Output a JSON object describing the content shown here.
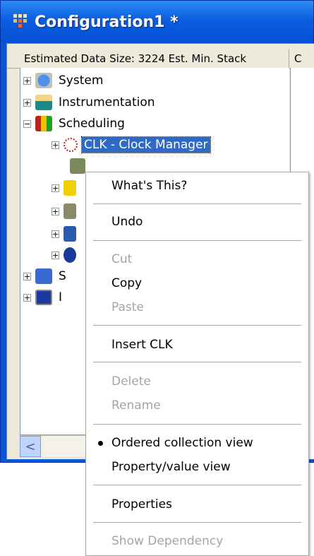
{
  "window": {
    "title": "Configuration1 *",
    "accent_color": "#0a57d6"
  },
  "header": {
    "column_1": "Estimated Data Size: 3224   Est. Min. Stack",
    "column_2": "C"
  },
  "tree": {
    "items": [
      {
        "label": "System",
        "expander": "+",
        "icon": "system-globe-icon"
      },
      {
        "label": "Instrumentation",
        "expander": "+",
        "icon": "instrumentation-folder-icon"
      },
      {
        "label": "Scheduling",
        "expander": "−",
        "icon": "scheduling-stoplight-icon"
      },
      {
        "label": "CLK - Clock Manager",
        "expander": "+",
        "icon": "clock-icon",
        "selected": true
      },
      {
        "label": "",
        "expander": "",
        "icon": "gear-icon"
      },
      {
        "label": "",
        "expander": "+",
        "icon": "sun-icon"
      },
      {
        "label": "",
        "expander": "+",
        "icon": "stack-icon"
      },
      {
        "label": "",
        "expander": "+",
        "icon": "blue-shapes-icon"
      },
      {
        "label": "",
        "expander": "+",
        "icon": "blue-q-icon"
      },
      {
        "label": "S",
        "expander": "+",
        "icon": "sync-icon"
      },
      {
        "label": "I",
        "expander": "+",
        "icon": "monitor-icon"
      }
    ]
  },
  "context_menu": {
    "items": [
      {
        "label": "What's This?",
        "enabled": true
      },
      {
        "label": "Undo",
        "enabled": true
      },
      {
        "label": "Cut",
        "enabled": false
      },
      {
        "label": "Copy",
        "enabled": true
      },
      {
        "label": "Paste",
        "enabled": false
      },
      {
        "label": "Insert CLK",
        "enabled": true
      },
      {
        "label": "Delete",
        "enabled": false
      },
      {
        "label": "Rename",
        "enabled": false
      },
      {
        "label": "Ordered collection view",
        "enabled": true,
        "checked": true
      },
      {
        "label": "Property/value view",
        "enabled": true
      },
      {
        "label": "Properties",
        "enabled": true
      },
      {
        "label": "Show Dependency",
        "enabled": false
      }
    ]
  },
  "scrollbar": {
    "left_arrow": "<"
  }
}
